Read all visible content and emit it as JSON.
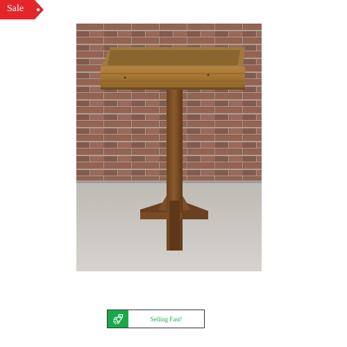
{
  "sale_tag": {
    "label": "Sale",
    "color": "#e2262a"
  },
  "product": {
    "image_icon": "wooden-bird-table-photo"
  },
  "badge": {
    "label": "Selling Fast!",
    "icon": "rocket-icon",
    "color": "#1aa94a"
  }
}
